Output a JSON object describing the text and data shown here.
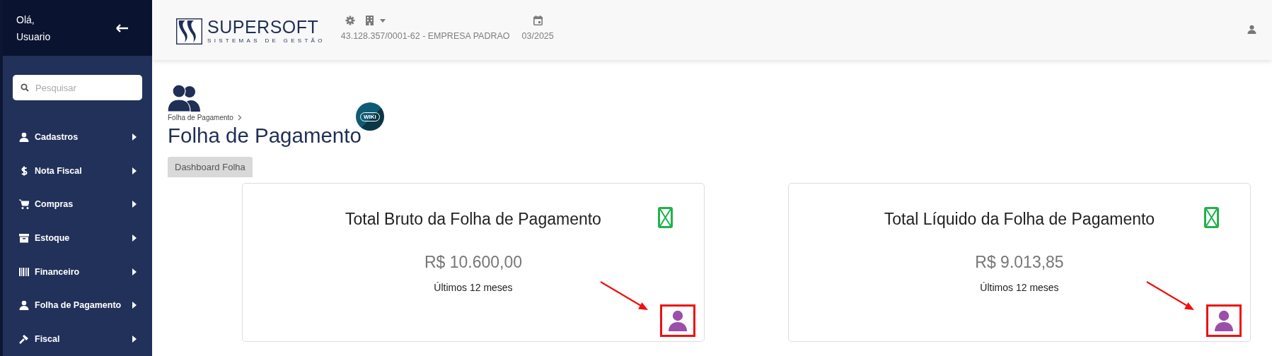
{
  "sidebar": {
    "greeting": [
      "Olá,",
      "Usuario"
    ],
    "search": {
      "placeholder": "Pesquisar"
    },
    "items": [
      {
        "label": "Cadastros",
        "selected": false
      },
      {
        "label": "Nota Fiscal",
        "selected": false
      },
      {
        "label": "Compras",
        "selected": false
      },
      {
        "label": "Estoque",
        "selected": false
      },
      {
        "label": "Financeiro",
        "selected": false
      },
      {
        "label": "Folha de Pagamento",
        "selected": false
      },
      {
        "label": "Fiscal",
        "selected": false
      }
    ]
  },
  "header": {
    "logo": {
      "name": "SUPERSOFT",
      "tagline": "SISTEMAS DE GESTÃO"
    },
    "company": "43.128.357/0001-62 - EMPRESA PADRAO",
    "period": "03/2025"
  },
  "page": {
    "breadcrumb": "Folha de Pagamento",
    "title": "Folha de Pagamento",
    "wiki": "WIKI",
    "tabs": [
      {
        "label": "Dashboard Folha",
        "selected": true
      }
    ]
  },
  "cards": [
    {
      "title": "Total Bruto da Folha de Pagamento",
      "value": "R$ 10.600,00",
      "caption": "Últimos 12 meses",
      "annotated": true
    },
    {
      "title": "Total Líquido da Folha de Pagamento",
      "value": "R$ 9.013,85",
      "caption": "Últimos 12 meses",
      "annotated": true
    }
  ]
}
